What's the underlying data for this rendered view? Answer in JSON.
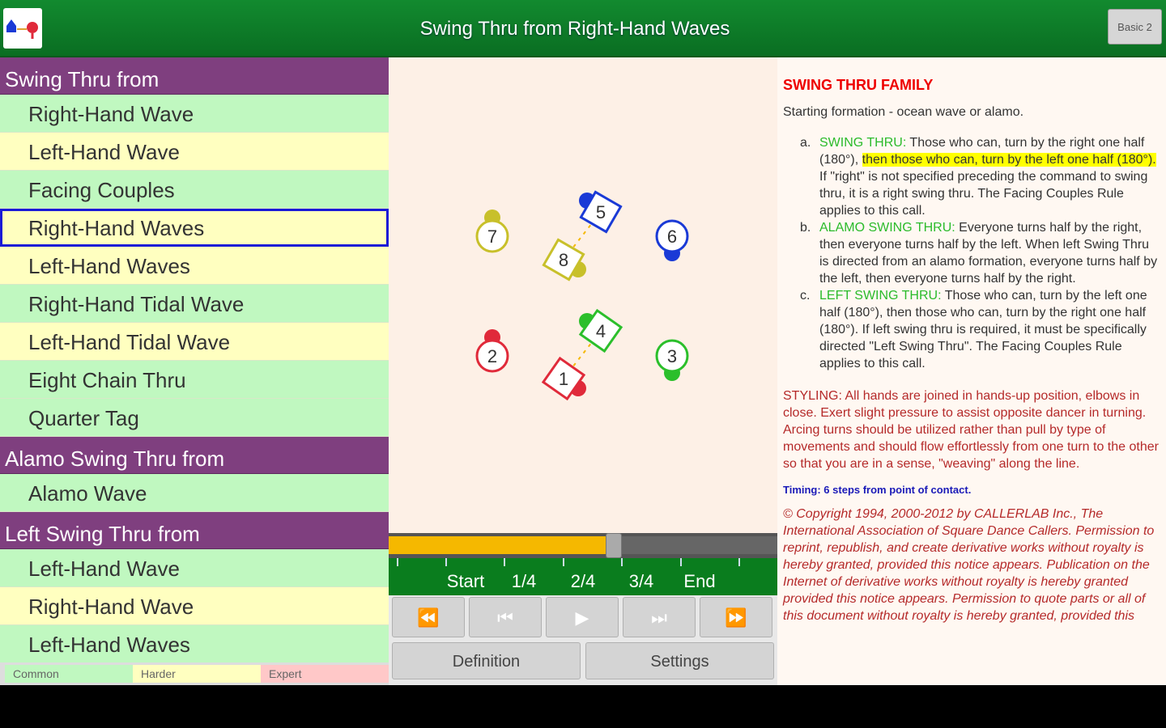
{
  "header": {
    "title": "Swing Thru from Right-Hand Waves",
    "level_button": "Basic 2"
  },
  "sidebar": {
    "sections": [
      {
        "title": "Swing Thru from",
        "items": [
          {
            "label": "Right-Hand Wave",
            "level": "common"
          },
          {
            "label": "Left-Hand Wave",
            "level": "harder"
          },
          {
            "label": "Facing Couples",
            "level": "common"
          },
          {
            "label": "Right-Hand Waves",
            "level": "harder",
            "selected": true
          },
          {
            "label": "Left-Hand Waves",
            "level": "harder"
          },
          {
            "label": "Right-Hand Tidal Wave",
            "level": "common"
          },
          {
            "label": "Left-Hand Tidal Wave",
            "level": "harder"
          },
          {
            "label": "Eight Chain Thru",
            "level": "common"
          },
          {
            "label": "Quarter Tag",
            "level": "common"
          }
        ]
      },
      {
        "title": "Alamo Swing Thru from",
        "items": [
          {
            "label": "Alamo Wave",
            "level": "common"
          }
        ]
      },
      {
        "title": "Left Swing Thru from",
        "items": [
          {
            "label": "Left-Hand Wave",
            "level": "common"
          },
          {
            "label": "Right-Hand Wave",
            "level": "harder"
          },
          {
            "label": "Left-Hand Waves",
            "level": "common"
          }
        ]
      }
    ],
    "legend": {
      "common": "Common",
      "harder": "Harder",
      "expert": "Expert"
    }
  },
  "diagram": {
    "dancers": [
      {
        "num": "1",
        "color": "#e02a3a"
      },
      {
        "num": "2",
        "color": "#e02a3a"
      },
      {
        "num": "3",
        "color": "#2bbf2b"
      },
      {
        "num": "4",
        "color": "#2bbf2b"
      },
      {
        "num": "5",
        "color": "#1a3ad6"
      },
      {
        "num": "6",
        "color": "#1a3ad6"
      },
      {
        "num": "7",
        "color": "#c8c02a"
      },
      {
        "num": "8",
        "color": "#c8c02a"
      }
    ]
  },
  "playback": {
    "progress": 0.58,
    "labels": [
      "Start",
      "1/4",
      "2/4",
      "3/4",
      "End"
    ],
    "buttons": {
      "rewind": "⏪",
      "step_back": "⏮",
      "play": "▶",
      "step_forward": "⏭",
      "fast_forward": "⏩"
    },
    "definition": "Definition",
    "settings": "Settings"
  },
  "definition": {
    "family": "SWING THRU FAMILY",
    "starting": "Starting formation - ocean wave or alamo.",
    "items": [
      {
        "letter": "a.",
        "name": "SWING THRU:",
        "text_a": "Those who can, turn by the right one half (180°),",
        "highlight": "then those who can, turn by the left one half (180°).",
        "text_b": "If \"right\" is not specified preceding the command to swing thru, it is a right swing thru. The Facing Couples Rule applies to this call."
      },
      {
        "letter": "b.",
        "name": "ALAMO SWING THRU:",
        "text_a": "Everyone turns half by the right, then everyone turns half by the left. When left Swing Thru is directed from an alamo formation, everyone turns half by the left, then everyone turns half by the right.",
        "highlight": "",
        "text_b": ""
      },
      {
        "letter": "c.",
        "name": "LEFT SWING THRU:",
        "text_a": "Those who can, turn by the left one half (180°), then those who can, turn by the right one half (180°). If left swing thru is required, it must be specifically directed \"Left Swing Thru\". The Facing Couples Rule applies to this call.",
        "highlight": "",
        "text_b": ""
      }
    ],
    "styling": "STYLING: All hands are joined in hands-up position, elbows in close. Exert slight pressure to assist opposite dancer in turning. Arcing turns should be utilized rather than pull by type of movements and should flow effortlessly from one turn to the other so that you are in a sense, \"weaving\" along the line.",
    "timing": "Timing: 6 steps from point of contact.",
    "copyright": "© Copyright 1994, 2000-2012 by CALLERLAB Inc., The International Association of Square Dance Callers. Permission to reprint, republish, and create derivative works without royalty is hereby granted, provided this notice appears. Publication on the Internet of derivative works without royalty is hereby granted provided this notice appears. Permission to quote parts or all of this document without royalty is hereby granted, provided this"
  }
}
